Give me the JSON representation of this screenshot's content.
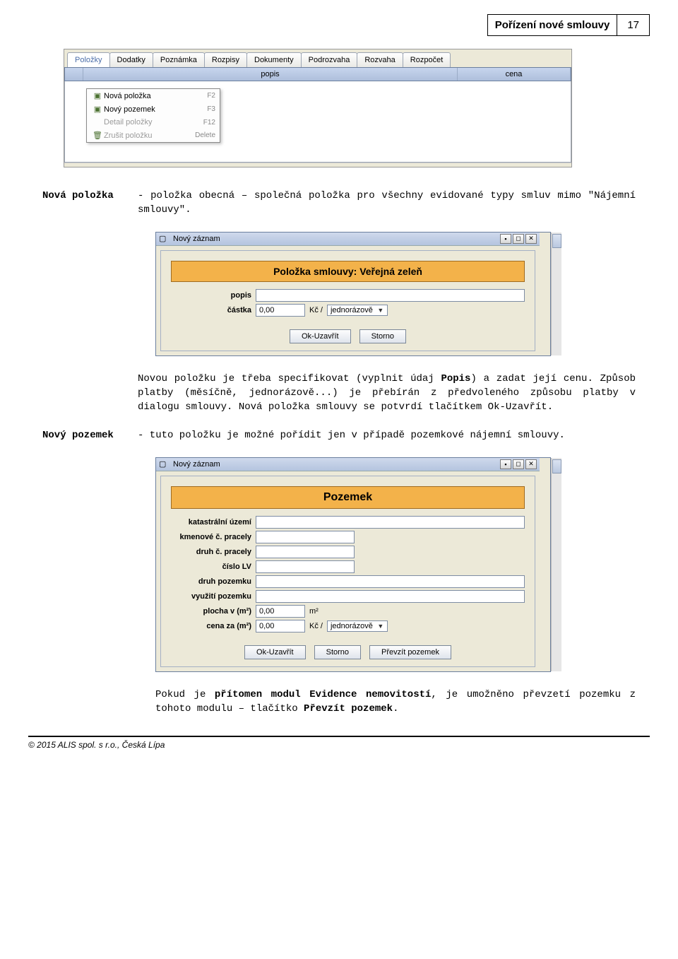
{
  "header": {
    "title": "Pořízení nové smlouvy",
    "page": "17"
  },
  "shot1": {
    "tabs": [
      "Položky",
      "Dodatky",
      "Poznámka",
      "Rozpisy",
      "Dokumenty",
      "Podrozvaha",
      "Rozvaha",
      "Rozpočet"
    ],
    "columns": {
      "popis": "popis",
      "cena": "cena"
    },
    "menu": [
      {
        "label": "Nová položka",
        "shortcut": "F2",
        "disabled": false
      },
      {
        "label": "Nový pozemek",
        "shortcut": "F3",
        "disabled": false
      },
      {
        "label": "Detail položky",
        "shortcut": "F12",
        "disabled": true
      },
      {
        "label": "Zrušit položku",
        "shortcut": "Delete",
        "disabled": true
      }
    ]
  },
  "def1": {
    "term": "Nová položka",
    "body_pre": "- položka obecná – společná položka pro všechny evidované typy smluv mimo \"Nájemní smlouvy\"."
  },
  "dialog1": {
    "title": "Nový záznam",
    "banner": "Položka smlouvy: Veřejná zeleň",
    "labels": {
      "popis": "popis",
      "castka": "částka"
    },
    "castka_value": "0,00",
    "unit": "Kč /",
    "freq": "jednorázově",
    "buttons": {
      "ok": "Ok-Uzavřít",
      "storno": "Storno"
    }
  },
  "para1": {
    "l1_a": "Novou položku je třeba specifikovat (vyplnit údaj ",
    "l1_bold": "Popis",
    "l1_b": ") a zadat její cenu. Způsob platby (měsíčně, jednorázově...) je přebírán z předvoleného způsobu platby v dialogu smlouvy. Nová položka smlouvy se potvrdí tlačítkem Ok-Uzavřít."
  },
  "def2": {
    "term": "Nový pozemek",
    "body": "- tuto položku je možné pořídit jen v případě pozemkové nájemní smlouvy."
  },
  "dialog2": {
    "title": "Nový záznam",
    "banner": "Pozemek",
    "labels": {
      "ku": "katastrální území",
      "kmen": "kmenové č. pracely",
      "druhc": "druh č. pracely",
      "lv": "číslo LV",
      "druhp": "druh pozemku",
      "vyuz": "využití pozemku",
      "plocha": "plocha v (m²)",
      "cena": "cena za (m²)"
    },
    "plocha_value": "0,00",
    "plocha_unit": "m²",
    "cena_value": "0,00",
    "cena_unit": "Kč /",
    "cena_freq": "jednorázově",
    "buttons": {
      "ok": "Ok-Uzavřít",
      "storno": "Storno",
      "prevzit": "Převzít pozemek"
    }
  },
  "footnote": {
    "a": "Pokud je ",
    "b1": "přítomen modul Evidence nemovitostí",
    "c": ", je umožněno převzetí pozemku z tohoto modulu – tlačítko ",
    "b2": "Převzít pozemek",
    "d": "."
  },
  "copyright": "© 2015 ALIS spol. s r.o., Česká Lípa"
}
